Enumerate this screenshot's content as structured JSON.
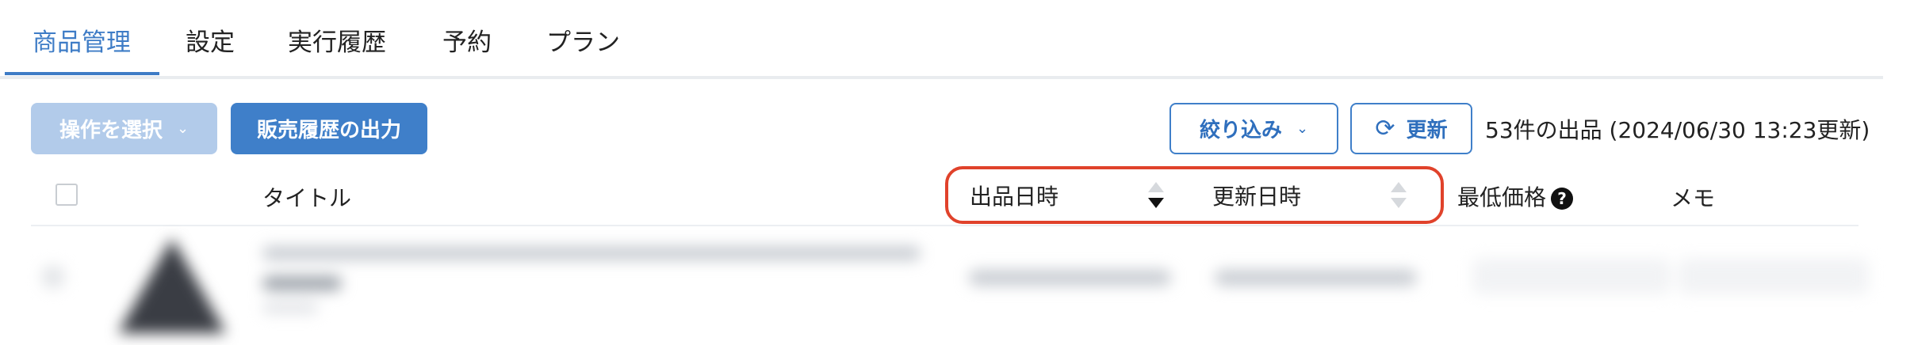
{
  "tabs": [
    {
      "label": "商品管理",
      "active": true
    },
    {
      "label": "設定",
      "active": false
    },
    {
      "label": "実行履歴",
      "active": false
    },
    {
      "label": "予約",
      "active": false
    },
    {
      "label": "プラン",
      "active": false
    }
  ],
  "toolbar": {
    "action_select_label": "操作を選択",
    "sales_history_label": "販売履歴の出力",
    "filter_label": "絞り込み",
    "refresh_label": "更新",
    "count_text": "53件の出品 (2024/06/30 13:23更新)"
  },
  "table": {
    "columns": {
      "title": "タイトル",
      "listed_at": "出品日時",
      "updated_at": "更新日時",
      "min_price": "最低価格",
      "memo": "メモ"
    },
    "help_glyph": "?"
  },
  "colors": {
    "accent": "#3e7cc6",
    "highlight": "#e0422b",
    "disabled_button": "#b2cbea"
  }
}
